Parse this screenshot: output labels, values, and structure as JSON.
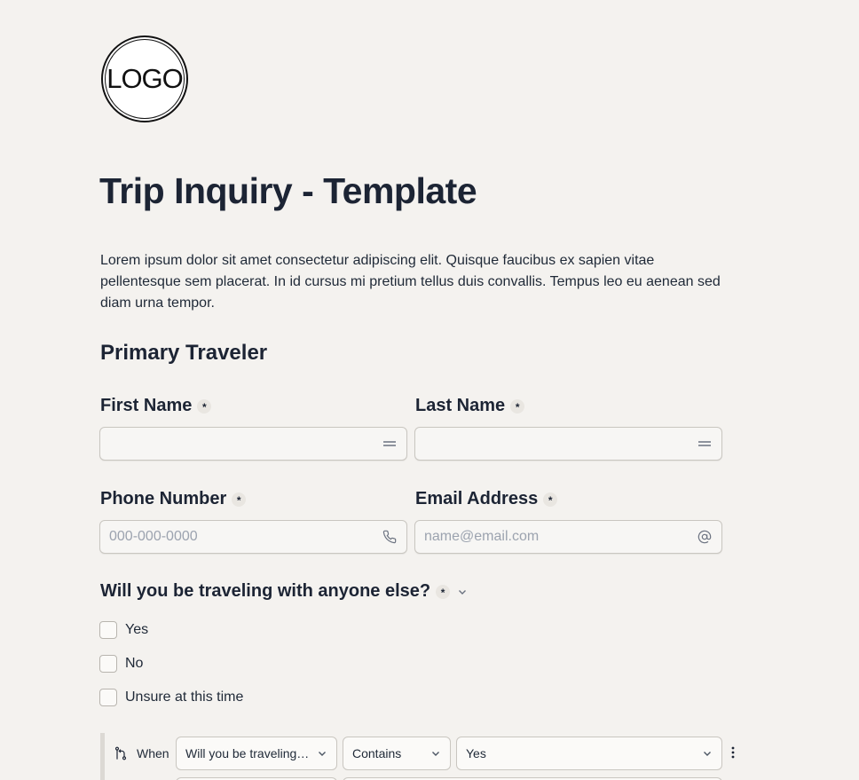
{
  "logo": {
    "text": "LOGO"
  },
  "form": {
    "title": "Trip Inquiry - Template",
    "description": "Lorem ipsum dolor sit amet consectetur adipiscing elit. Quisque faucibus ex sapien vitae pellentesque sem placerat. In id cursus mi pretium tellus duis convallis. Tempus leo eu aenean sed diam urna tempor.",
    "section_title": "Primary Traveler",
    "required_mark": "*"
  },
  "fields": {
    "first_name": {
      "label": "First Name",
      "value": "",
      "placeholder": "",
      "icon": "text-lines-icon"
    },
    "last_name": {
      "label": "Last Name",
      "value": "",
      "placeholder": "",
      "icon": "text-lines-icon"
    },
    "phone": {
      "label": "Phone Number",
      "value": "",
      "placeholder": "000-000-0000",
      "icon": "phone-icon"
    },
    "email": {
      "label": "Email Address",
      "value": "",
      "placeholder": "name@email.com",
      "icon": "at-icon"
    }
  },
  "question": {
    "label": "Will you be traveling with anyone else?",
    "options": [
      "Yes",
      "No",
      "Unsure at this time"
    ]
  },
  "logic": {
    "when_label": "When",
    "field_select": "Will you be traveling with anyone else?",
    "operator_select": "Contains",
    "value_select": "Yes"
  },
  "colors": {
    "background": "#f4f2ef",
    "text": "#1c2434",
    "border": "#c9c6c0"
  }
}
